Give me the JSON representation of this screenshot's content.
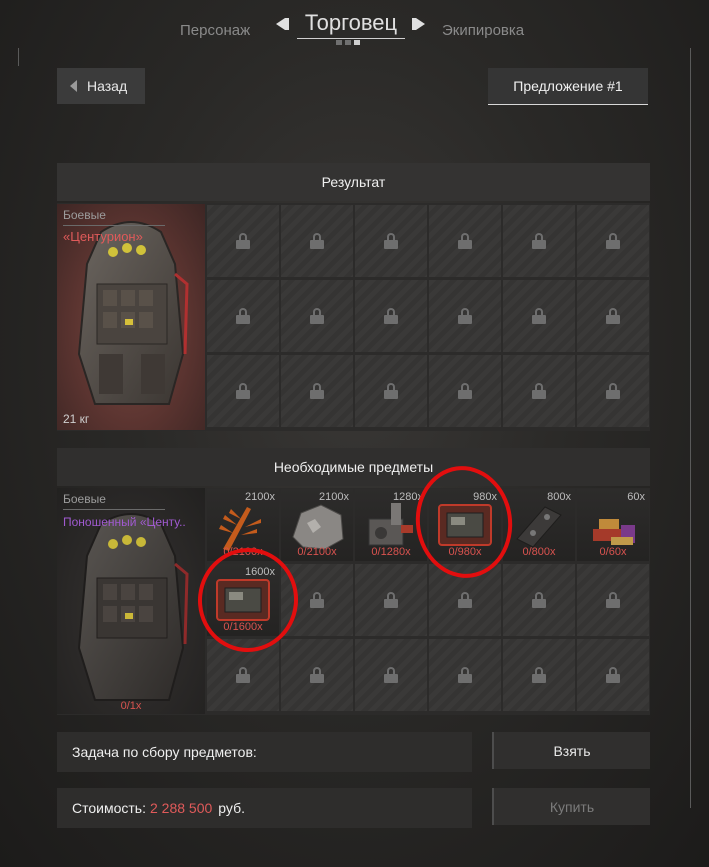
{
  "nav": {
    "left_tab": "Персонаж",
    "title": "Торговец",
    "right_tab": "Экипировка"
  },
  "back_label": "Назад",
  "offer_label": "Предложение #1",
  "result": {
    "header": "Результат",
    "category": "Боевые",
    "name": "«Центурион»",
    "weight": "21 кг"
  },
  "required": {
    "header": "Необходимые предметы",
    "category": "Боевые",
    "name": "Поношенный «Центу..",
    "have": "0/1x",
    "items": [
      {
        "qty": "2100x",
        "have": "0/2100x",
        "icon": "fern-plant-icon"
      },
      {
        "qty": "2100x",
        "have": "0/2100x",
        "icon": "rock-ore-icon"
      },
      {
        "qty": "1280x",
        "have": "0/1280x",
        "icon": "machine-part-icon"
      },
      {
        "qty": "980x",
        "have": "0/980x",
        "icon": "case-icon"
      },
      {
        "qty": "800x",
        "have": "0/800x",
        "icon": "metal-part-icon"
      },
      {
        "qty": "60x",
        "have": "0/60x",
        "icon": "ammo-pile-icon"
      },
      {
        "qty": "1600x",
        "have": "0/1600x",
        "icon": "case-icon"
      }
    ]
  },
  "task_label": "Задача по сбору предметов:",
  "cost": {
    "label": "Стоимость:",
    "value": "2 288 500",
    "currency": "руб."
  },
  "take_label": "Взять",
  "buy_label": "Купить",
  "colors": {
    "accent_red": "#d9534f",
    "annotation": "#e20e0e",
    "rarity_purple": "#a05ad0",
    "rarity_red": "#e05a5a"
  }
}
